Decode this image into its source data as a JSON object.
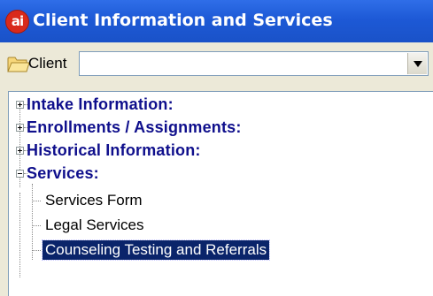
{
  "window": {
    "title": "Client Information and Services",
    "icon_text": "ai"
  },
  "toolbar": {
    "client_label": "Client",
    "client_value": ""
  },
  "tree": {
    "groups": [
      {
        "label": "Intake Information:",
        "expanded": false
      },
      {
        "label": "Enrollments / Assignments:",
        "expanded": false
      },
      {
        "label": "Historical Information:",
        "expanded": false
      },
      {
        "label": "Services:",
        "expanded": true
      }
    ],
    "service_items": [
      {
        "label": "Services Form",
        "selected": false
      },
      {
        "label": "Legal Services",
        "selected": false
      },
      {
        "label": "Counseling Testing and Referrals",
        "selected": true
      }
    ]
  },
  "colors": {
    "titlebar": "#1d59d6",
    "group_text": "#0f0f8c",
    "selection": "#0a246a"
  }
}
